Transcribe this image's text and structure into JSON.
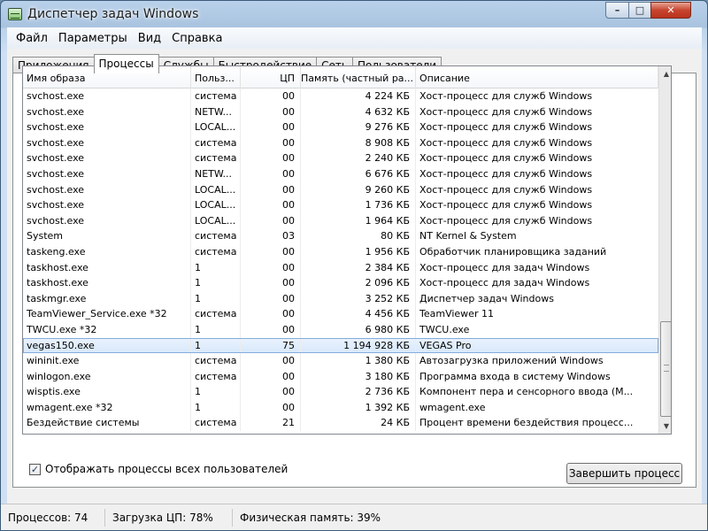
{
  "window": {
    "title": "Диспетчер задач Windows",
    "min": "–",
    "max": "□",
    "close": "✕"
  },
  "menu": [
    "Файл",
    "Параметры",
    "Вид",
    "Справка"
  ],
  "tabs": [
    "Приложения",
    "Процессы",
    "Службы",
    "Быстродействие",
    "Сеть",
    "Пользователи"
  ],
  "columns": {
    "name": "Имя образа",
    "user": "Польз...",
    "cpu": "ЦП",
    "mem": "Память (частный ра...",
    "desc": "Описание"
  },
  "processes": [
    {
      "name": "svchost.exe",
      "user": "система",
      "cpu": "00",
      "mem": "4 224 КБ",
      "desc": "Хост-процесс для служб Windows"
    },
    {
      "name": "svchost.exe",
      "user": "NETW...",
      "cpu": "00",
      "mem": "4 632 КБ",
      "desc": "Хост-процесс для служб Windows"
    },
    {
      "name": "svchost.exe",
      "user": "LOCAL...",
      "cpu": "00",
      "mem": "9 276 КБ",
      "desc": "Хост-процесс для служб Windows"
    },
    {
      "name": "svchost.exe",
      "user": "система",
      "cpu": "00",
      "mem": "8 908 КБ",
      "desc": "Хост-процесс для служб Windows"
    },
    {
      "name": "svchost.exe",
      "user": "система",
      "cpu": "00",
      "mem": "2 240 КБ",
      "desc": "Хост-процесс для служб Windows"
    },
    {
      "name": "svchost.exe",
      "user": "NETW...",
      "cpu": "00",
      "mem": "6 676 КБ",
      "desc": "Хост-процесс для служб Windows"
    },
    {
      "name": "svchost.exe",
      "user": "LOCAL...",
      "cpu": "00",
      "mem": "9 260 КБ",
      "desc": "Хост-процесс для служб Windows"
    },
    {
      "name": "svchost.exe",
      "user": "LOCAL...",
      "cpu": "00",
      "mem": "1 736 КБ",
      "desc": "Хост-процесс для служб Windows"
    },
    {
      "name": "svchost.exe",
      "user": "LOCAL...",
      "cpu": "00",
      "mem": "1 964 КБ",
      "desc": "Хост-процесс для служб Windows"
    },
    {
      "name": "System",
      "user": "система",
      "cpu": "03",
      "mem": "80 КБ",
      "desc": "NT Kernel & System"
    },
    {
      "name": "taskeng.exe",
      "user": "система",
      "cpu": "00",
      "mem": "1 956 КБ",
      "desc": "Обработчик планировщика заданий"
    },
    {
      "name": "taskhost.exe",
      "user": "1",
      "cpu": "00",
      "mem": "2 384 КБ",
      "desc": "Хост-процесс для задач Windows"
    },
    {
      "name": "taskhost.exe",
      "user": "1",
      "cpu": "00",
      "mem": "2 096 КБ",
      "desc": "Хост-процесс для задач Windows"
    },
    {
      "name": "taskmgr.exe",
      "user": "1",
      "cpu": "00",
      "mem": "3 252 КБ",
      "desc": "Диспетчер задач Windows"
    },
    {
      "name": "TeamViewer_Service.exe *32",
      "user": "система",
      "cpu": "00",
      "mem": "4 456 КБ",
      "desc": "TeamViewer 11"
    },
    {
      "name": "TWCU.exe *32",
      "user": "1",
      "cpu": "00",
      "mem": "6 980 КБ",
      "desc": "TWCU.exe"
    },
    {
      "name": "vegas150.exe",
      "user": "1",
      "cpu": "75",
      "mem": "1 194 928 КБ",
      "desc": "VEGAS Pro",
      "selected": true
    },
    {
      "name": "wininit.exe",
      "user": "система",
      "cpu": "00",
      "mem": "1 380 КБ",
      "desc": "Автозагрузка приложений Windows"
    },
    {
      "name": "winlogon.exe",
      "user": "система",
      "cpu": "00",
      "mem": "3 180 КБ",
      "desc": "Программа входа в систему Windows"
    },
    {
      "name": "wisptis.exe",
      "user": "1",
      "cpu": "00",
      "mem": "2 736 КБ",
      "desc": "Компонент пера и сенсорного ввода (М..."
    },
    {
      "name": "wmagent.exe *32",
      "user": "1",
      "cpu": "00",
      "mem": "1 392 КБ",
      "desc": "wmagent.exe"
    },
    {
      "name": "Бездействие системы",
      "user": "система",
      "cpu": "21",
      "mem": "24 КБ",
      "desc": "Процент времени бездействия процесс..."
    }
  ],
  "show_all_users": {
    "label": "Отображать процессы всех пользователей",
    "checked": true
  },
  "end_process_label": "Завершить процесс",
  "status": {
    "processes": "Процессов: 74",
    "cpu": "Загрузка ЦП: 78%",
    "memory": "Физическая память: 39%"
  },
  "scrollbar": {
    "up": "▲",
    "down": "▼"
  }
}
